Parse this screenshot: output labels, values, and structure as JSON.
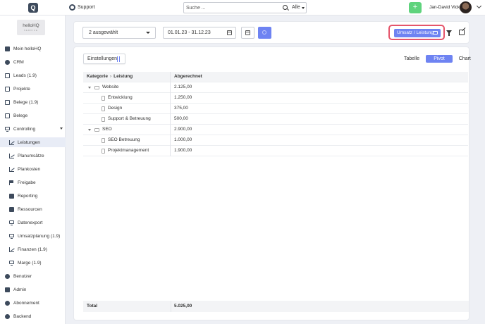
{
  "topbar": {
    "logo_text": "Q",
    "support_label": "Support",
    "search_placeholder": "Suche ...",
    "search_scope": "Alle",
    "add_label": "+",
    "user_name": "Jan-David Vick"
  },
  "sidebar": {
    "brand_text": "helloHQ",
    "brand_sub": "SERVICE",
    "items": [
      {
        "label": "Mein helloHQ",
        "icon": "grid-icon"
      },
      {
        "label": "CRM",
        "icon": "crm-icon"
      },
      {
        "label": "Leads (1.9)",
        "icon": "leads-icon"
      },
      {
        "label": "Projekte",
        "icon": "projects-icon"
      },
      {
        "label": "Belege (1.9)",
        "icon": "receipts-icon"
      },
      {
        "label": "Belege",
        "icon": "receipts-icon"
      },
      {
        "label": "Controlling",
        "icon": "controlling-icon"
      },
      {
        "label": "Leistungen",
        "icon": "chart-icon"
      },
      {
        "label": "Planumsätze",
        "icon": "chart-icon"
      },
      {
        "label": "Plankosten",
        "icon": "chart-icon"
      },
      {
        "label": "Freigabe",
        "icon": "flag-icon"
      },
      {
        "label": "Reporting",
        "icon": "rocket-icon"
      },
      {
        "label": "Ressourcen",
        "icon": "resources-icon"
      },
      {
        "label": "Datenexport",
        "icon": "monitor-icon"
      },
      {
        "label": "Umsatzplanung (1.9)",
        "icon": "monitor-icon"
      },
      {
        "label": "Finanzen (1.9)",
        "icon": "chart-icon"
      },
      {
        "label": "Marge (1.9)",
        "icon": "monitor-icon"
      },
      {
        "label": "Benutzer",
        "icon": "users-icon"
      },
      {
        "label": "Admin",
        "icon": "tools-icon"
      },
      {
        "label": "Abonnement",
        "icon": "subscription-icon"
      },
      {
        "label": "Backend",
        "icon": "backend-icon"
      }
    ]
  },
  "toolbar": {
    "selection": "2 ausgewählt",
    "date_range": "01.01.23 - 31.12.23",
    "view_label": "Umsatz / Leistung"
  },
  "main": {
    "settings_label": "Einstellungen",
    "tabs": [
      "Tabelle",
      "Pivot",
      "Chart"
    ],
    "active_tab": "Pivot",
    "header": {
      "col1a": "Kategorie",
      "col1b": "Leistung",
      "col2": "Abgerechnet"
    },
    "rows": [
      {
        "type": "group",
        "label": "Website",
        "value": "2.125,00"
      },
      {
        "type": "sub",
        "label": "Entwicklung",
        "value": "1.250,00"
      },
      {
        "type": "sub",
        "label": "Design",
        "value": "375,00"
      },
      {
        "type": "sub",
        "label": "Support & Betreuung",
        "value": "500,00"
      },
      {
        "type": "group",
        "label": "SEO",
        "value": "2.900,00"
      },
      {
        "type": "sub",
        "label": "SEO Betreuung",
        "value": "1.000,00"
      },
      {
        "type": "sub",
        "label": "Projektmanagement",
        "value": "1.900,00"
      }
    ],
    "total_label": "Total",
    "total_value": "5.025,00"
  },
  "colors": {
    "accent": "#6e83f2",
    "add_button": "#5fd37d",
    "highlight": "#e5556b",
    "sidebar_active": "#e8ecf6"
  }
}
